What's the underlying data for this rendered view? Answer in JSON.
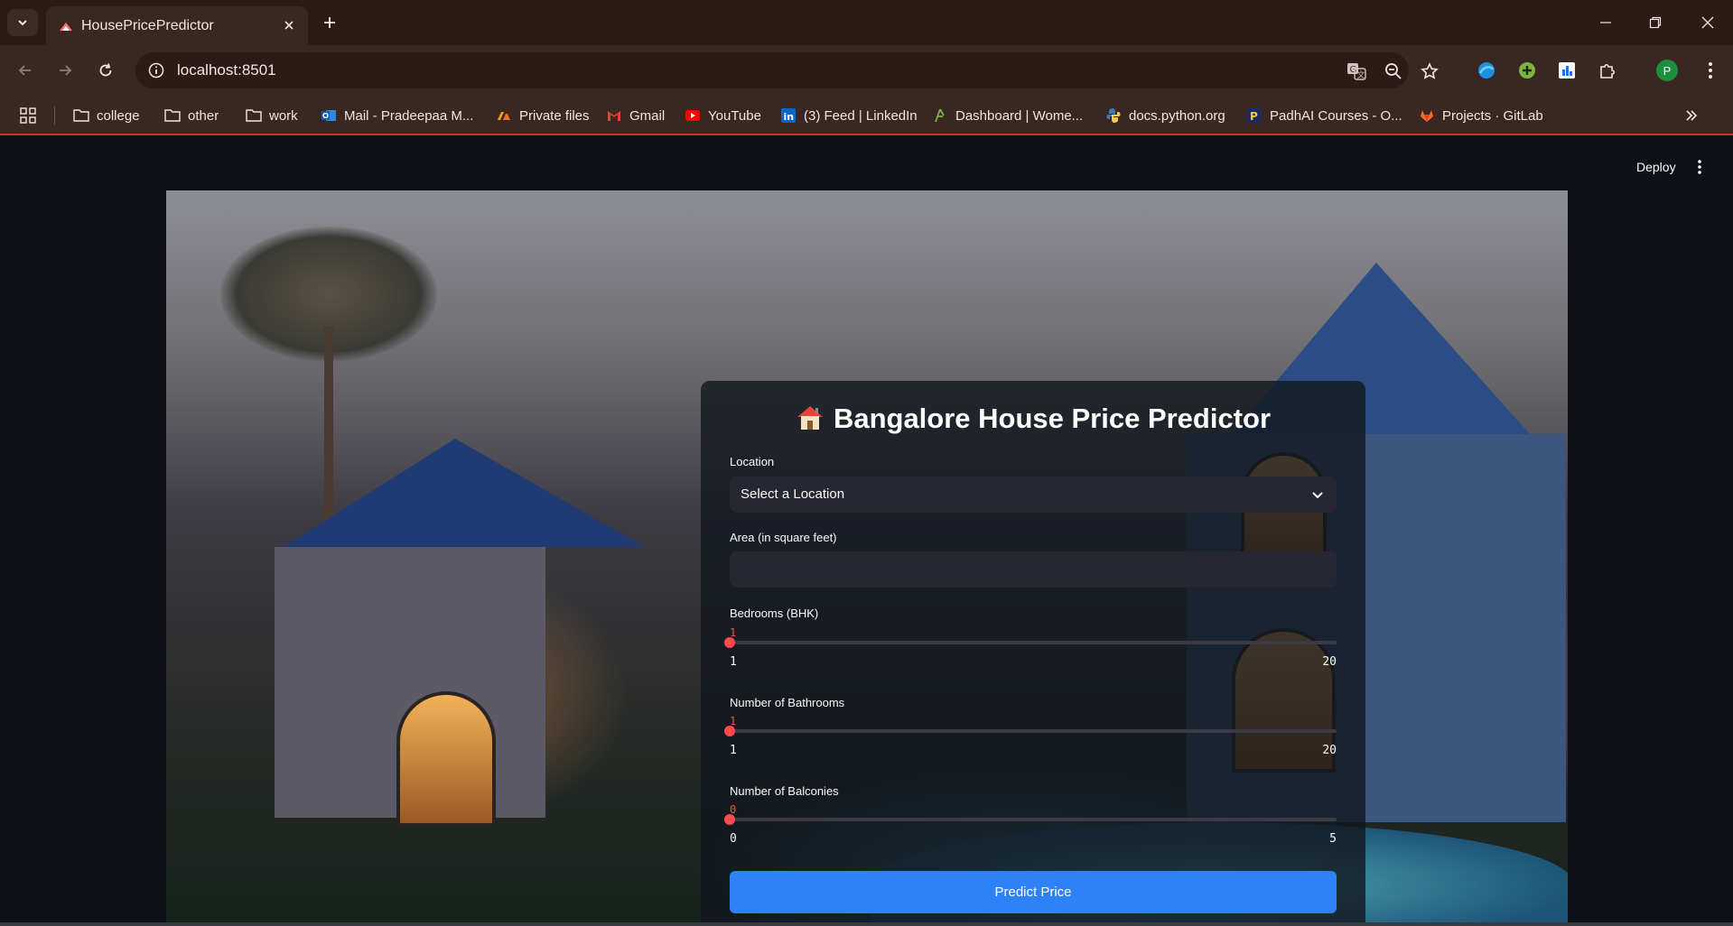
{
  "browser": {
    "tab_title": "HousePricePredictor",
    "url": "localhost:8501",
    "profile_initial": "P",
    "bookmarks": [
      {
        "label": "college",
        "icon": "folder-icon"
      },
      {
        "label": "other",
        "icon": "folder-icon"
      },
      {
        "label": "work",
        "icon": "folder-icon"
      },
      {
        "label": "Mail - Pradeepaa M...",
        "icon": "outlook-icon"
      },
      {
        "label": "Private files",
        "icon": "drive-icon"
      },
      {
        "label": "Gmail",
        "icon": "gmail-icon"
      },
      {
        "label": "YouTube",
        "icon": "youtube-icon"
      },
      {
        "label": "(3) Feed | LinkedIn",
        "icon": "linkedin-icon"
      },
      {
        "label": "Dashboard | Wome...",
        "icon": "dashboard-icon"
      },
      {
        "label": "docs.python.org",
        "icon": "python-icon"
      },
      {
        "label": "PadhAI Courses - O...",
        "icon": "padhai-icon"
      },
      {
        "label": "Projects · GitLab",
        "icon": "gitlab-icon"
      }
    ]
  },
  "app": {
    "deploy_label": "Deploy",
    "title": "Bangalore House Price Predictor",
    "location": {
      "label": "Location",
      "selected": "Select a Location"
    },
    "area": {
      "label": "Area (in square feet)",
      "value": ""
    },
    "bedrooms": {
      "label": "Bedrooms (BHK)",
      "value": "1",
      "min": "1",
      "max": "20",
      "fraction": 0
    },
    "bathrooms": {
      "label": "Number of Bathrooms",
      "value": "1",
      "min": "1",
      "max": "20",
      "fraction": 0
    },
    "balconies": {
      "label": "Number of Balconies",
      "value": "0",
      "min": "0",
      "max": "5",
      "fraction": 0
    },
    "predict_label": "Predict Price"
  },
  "colors": {
    "accent": "#ff4b4b",
    "button": "#2f81f7",
    "background": "#0e1117",
    "chrome": "#3a2722"
  }
}
